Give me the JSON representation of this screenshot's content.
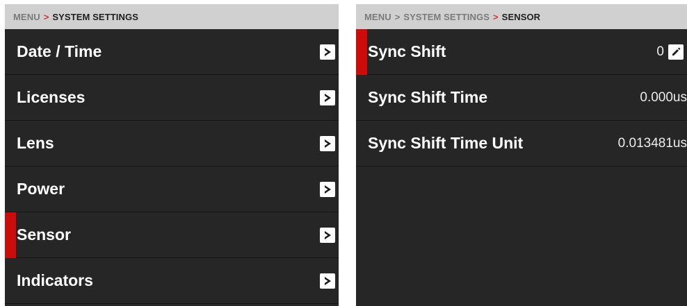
{
  "colors": {
    "accent": "#cc0b0b",
    "panel_bg": "#262626",
    "header_bg": "#d0d0d0",
    "header_text": "#7a7a7a",
    "header_current": "#1e1e1e",
    "breadcrumb_separator": "#d5322b"
  },
  "left": {
    "breadcrumb": {
      "root": "MENU",
      "separator": ">",
      "current": "SYSTEM SETTINGS"
    },
    "items": [
      {
        "label": "Date / Time",
        "icon": "chevron-right-icon"
      },
      {
        "label": "Licenses",
        "icon": "chevron-right-icon"
      },
      {
        "label": "Lens",
        "icon": "chevron-right-icon"
      },
      {
        "label": "Power",
        "icon": "chevron-right-icon"
      },
      {
        "label": "Sensor",
        "icon": "chevron-right-icon",
        "selected": true
      },
      {
        "label": "Indicators",
        "icon": "chevron-right-icon"
      }
    ]
  },
  "right": {
    "breadcrumb": {
      "root": "MENU",
      "separator": ">",
      "middle": "SYSTEM SETTINGS",
      "current": "SENSOR"
    },
    "items": [
      {
        "label": "Sync Shift",
        "value": "0",
        "icon": "pencil-icon",
        "selected": true
      },
      {
        "label": "Sync Shift Time",
        "value": "0.000us"
      },
      {
        "label": "Sync Shift Time Unit",
        "value": "0.013481us"
      }
    ]
  }
}
